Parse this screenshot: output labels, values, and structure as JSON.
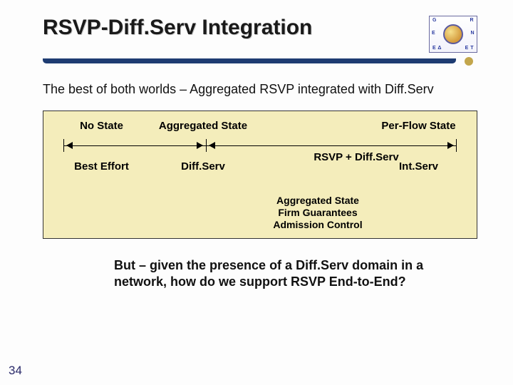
{
  "title": "RSVP-Diff.Serv Integration",
  "logo": {
    "top": "G R",
    "mid_left": "E",
    "mid_right": "N",
    "bottom_left": "Ε Δ",
    "bottom_right": "Ε Τ"
  },
  "subtitle": "The best of both worlds – Aggregated RSVP integrated with Diff.Serv",
  "diagram": {
    "top_labels": {
      "no_state": "No State",
      "agg_state": "Aggregated State",
      "per_flow": "Per-Flow State"
    },
    "axis_center_label": "RSVP + Diff.Serv",
    "bottom_labels": {
      "best_effort": "Best Effort",
      "diffserv": "Diff.Serv",
      "intserv": "Int.Serv"
    },
    "benefits": [
      "Aggregated State",
      "Firm Guarantees",
      "Admission Control"
    ]
  },
  "bottom_text": "But – given the presence of a Diff.Serv domain in a network, how do we support RSVP End-to-End?",
  "page_number": "34"
}
